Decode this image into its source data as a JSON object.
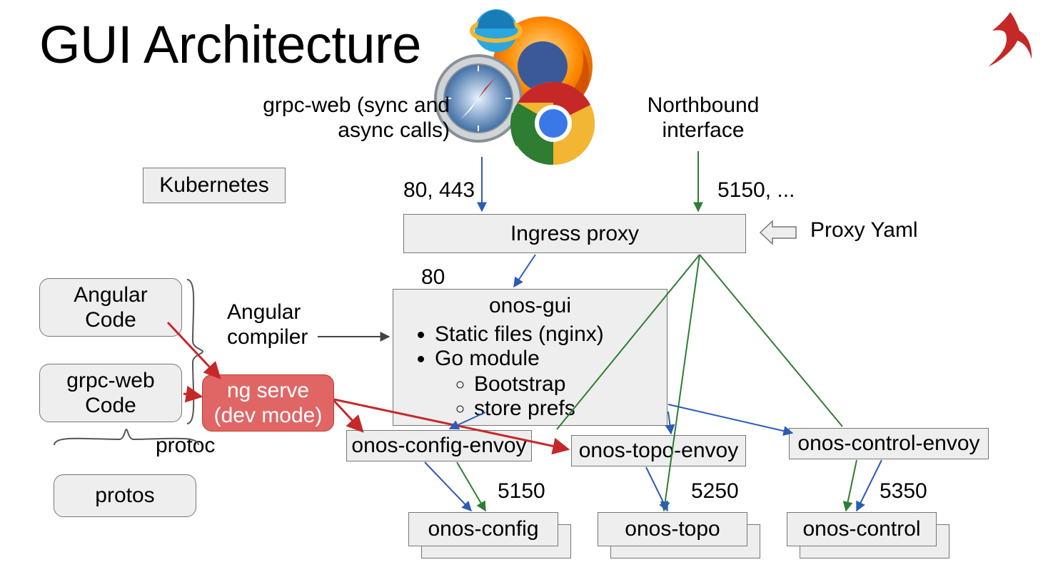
{
  "title": "GUI Architecture",
  "labels": {
    "grpc_web": "grpc-web (sync and\nasync calls)",
    "northbound": "Northbound\ninterface",
    "ports_web": "80, 443",
    "ports_nb": "5150, ...",
    "proxy_yaml": "Proxy Yaml",
    "port80": "80",
    "port5150": "5150",
    "port5250": "5250",
    "port5350": "5350",
    "angular_compiler": "Angular\ncompiler",
    "protoc": "protoc"
  },
  "boxes": {
    "kubernetes": "Kubernetes",
    "ingress": "Ingress proxy",
    "angular_code": "Angular\nCode",
    "grpc_web_code": "grpc-web\nCode",
    "protos": "protos",
    "ng_serve": "ng serve\n(dev mode)",
    "config_envoy": "onos-config-envoy",
    "topo_envoy": "onos-topo-envoy",
    "control_envoy": "onos-control-envoy",
    "onos_config": "onos-config",
    "onos_topo": "onos-topo",
    "onos_control": "onos-control"
  },
  "gui": {
    "title": "onos-gui",
    "items": [
      "Static files (nginx)",
      "Go module"
    ],
    "subitems": [
      "Bootstrap",
      "store prefs"
    ]
  },
  "chart_data": {
    "type": "diagram",
    "nodes": [
      {
        "id": "browsers",
        "label": "Browsers (IE, Firefox, Safari, Chrome)"
      },
      {
        "id": "ingress",
        "label": "Ingress proxy"
      },
      {
        "id": "onos-gui",
        "label": "onos-gui"
      },
      {
        "id": "kubernetes",
        "label": "Kubernetes"
      },
      {
        "id": "angular-code",
        "label": "Angular Code"
      },
      {
        "id": "grpc-web-code",
        "label": "grpc-web Code"
      },
      {
        "id": "protos",
        "label": "protos"
      },
      {
        "id": "ng-serve",
        "label": "ng serve (dev mode)"
      },
      {
        "id": "onos-config-envoy",
        "label": "onos-config-envoy"
      },
      {
        "id": "onos-topo-envoy",
        "label": "onos-topo-envoy"
      },
      {
        "id": "onos-control-envoy",
        "label": "onos-control-envoy"
      },
      {
        "id": "onos-config",
        "label": "onos-config"
      },
      {
        "id": "onos-topo",
        "label": "onos-topo"
      },
      {
        "id": "onos-control",
        "label": "onos-control"
      },
      {
        "id": "proxy-yaml",
        "label": "Proxy Yaml"
      }
    ],
    "edges": [
      {
        "from": "browsers",
        "to": "ingress",
        "label": "80, 443",
        "color": "blue"
      },
      {
        "from": "northbound",
        "to": "ingress",
        "label": "5150, ...",
        "color": "green"
      },
      {
        "from": "proxy-yaml",
        "to": "ingress",
        "kind": "input"
      },
      {
        "from": "ingress",
        "to": "onos-gui",
        "label": "80",
        "color": "blue"
      },
      {
        "from": "ingress",
        "to": "onos-config-envoy",
        "color": "green"
      },
      {
        "from": "ingress",
        "to": "onos-topo",
        "color": "green",
        "direct": true
      },
      {
        "from": "ingress",
        "to": "onos-control-envoy",
        "color": "green"
      },
      {
        "from": "angular-compiler",
        "to": "onos-gui",
        "color": "black"
      },
      {
        "from": "angular-code",
        "to": "ng-serve",
        "color": "red"
      },
      {
        "from": "grpc-web-code",
        "to": "ng-serve",
        "color": "red"
      },
      {
        "from": "ng-serve",
        "to": "onos-config-envoy",
        "color": "red"
      },
      {
        "from": "ng-serve",
        "to": "onos-topo-envoy",
        "color": "red"
      },
      {
        "from": "onos-gui",
        "to": "onos-config-envoy",
        "color": "blue"
      },
      {
        "from": "onos-gui",
        "to": "onos-topo-envoy",
        "color": "blue"
      },
      {
        "from": "onos-gui",
        "to": "onos-control-envoy",
        "color": "blue"
      },
      {
        "from": "onos-config-envoy",
        "to": "onos-config",
        "label": "5150",
        "color": "blue"
      },
      {
        "from": "onos-config-envoy",
        "to": "onos-config",
        "color": "green"
      },
      {
        "from": "onos-topo-envoy",
        "to": "onos-topo",
        "label": "5250",
        "color": "blue"
      },
      {
        "from": "onos-control-envoy",
        "to": "onos-control",
        "label": "5350",
        "color": "blue"
      },
      {
        "from": "onos-control-envoy",
        "to": "onos-control",
        "color": "green"
      }
    ]
  }
}
